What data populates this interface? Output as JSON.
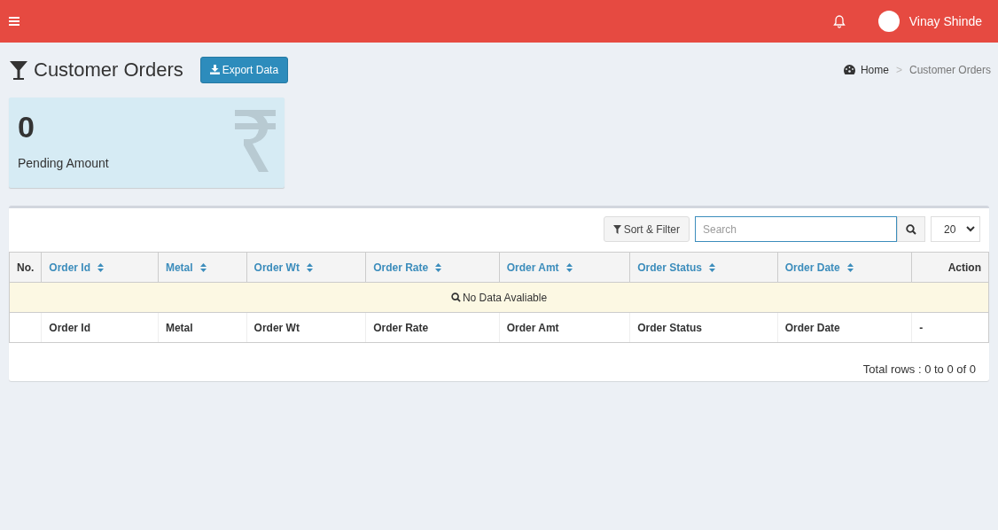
{
  "topbar": {
    "user_name": "Vinay Shinde"
  },
  "page": {
    "title": "Customer Orders",
    "export_button": "Export Data"
  },
  "breadcrumb": [
    "Home",
    "Customer Orders"
  ],
  "breadcrumb_separator": ">",
  "stat_card": {
    "value": "0",
    "label": "Pending Amount"
  },
  "toolbar": {
    "sort_filter_button": "Sort & Filter",
    "search": {
      "placeholder": "Search"
    },
    "page_size": "20"
  },
  "table": {
    "columns": [
      {
        "label": "No.",
        "sortable": false
      },
      {
        "label": "Order Id",
        "sortable": true
      },
      {
        "label": "Metal",
        "sortable": true
      },
      {
        "label": "Order Wt",
        "sortable": true
      },
      {
        "label": "Order Rate",
        "sortable": true
      },
      {
        "label": "Order Amt",
        "sortable": true
      },
      {
        "label": "Order Status",
        "sortable": true
      },
      {
        "label": "Order Date",
        "sortable": true
      },
      {
        "label": "Action",
        "sortable": false
      }
    ],
    "empty_message": "No Data Avaliable",
    "footer_row": [
      "Order Id",
      "Metal",
      "Order Wt",
      "Order Rate",
      "Order Amt",
      "Order Status",
      "Order Date",
      "-"
    ]
  },
  "total_rows": "Total rows : 0 to 0 of 0"
}
